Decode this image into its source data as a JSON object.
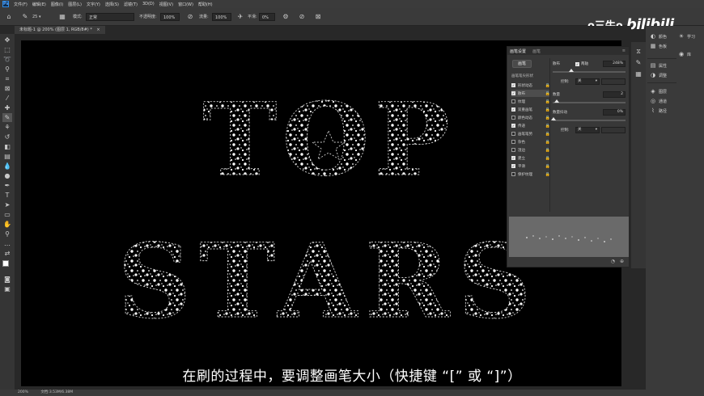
{
  "menu": {
    "logo": "Ps",
    "items": [
      "文件(F)",
      "编辑(E)",
      "图像(I)",
      "图层(L)",
      "文字(Y)",
      "选择(S)",
      "滤镜(T)",
      "3D(D)",
      "视图(V)",
      "窗口(W)",
      "帮助(H)"
    ]
  },
  "options": {
    "brush_size": "25",
    "mode_label": "模式:",
    "mode_value": "正常",
    "opacity_label": "不透明度:",
    "opacity_value": "100%",
    "flow_label": "流量:",
    "flow_value": "100%",
    "smooth_label": "平滑:",
    "smooth_value": "0%"
  },
  "document": {
    "tab_label": "未标题-1 @ 200% (图层 1, RGB/8#) *",
    "close": "×"
  },
  "canvas": {
    "line1": "TOP",
    "line2": "STARS"
  },
  "status": {
    "zoom": "200%",
    "doc": "文档:3.53M/6.38M"
  },
  "right_dock": {
    "items": [
      {
        "icon": "palette-icon",
        "label": "颜色"
      },
      {
        "icon": "swatches-icon",
        "label": "色板"
      },
      {
        "icon": "learn-icon",
        "label": "学习"
      },
      {
        "icon": "library-icon",
        "label": "库"
      },
      {
        "icon": "properties-icon",
        "label": "属性"
      },
      {
        "icon": "adjustments-icon",
        "label": "调整"
      },
      {
        "icon": "layers-icon",
        "label": "图层"
      },
      {
        "icon": "channels-icon",
        "label": "通道"
      },
      {
        "icon": "paths-icon",
        "label": "路径"
      }
    ]
  },
  "brush_panel": {
    "tabs": [
      "画笔设置",
      "画笔"
    ],
    "brushes_button": "画笔",
    "tip_shape_label": "画笔笔尖形状",
    "rows": [
      {
        "label": "形状动态",
        "checked": true,
        "active": false
      },
      {
        "label": "散布",
        "checked": true,
        "active": true
      },
      {
        "label": "纹理",
        "checked": false,
        "active": false
      },
      {
        "label": "双重画笔",
        "checked": true,
        "active": false
      },
      {
        "label": "颜色动态",
        "checked": false,
        "active": false
      },
      {
        "label": "传递",
        "checked": true,
        "active": false
      },
      {
        "label": "画笔笔势",
        "checked": false,
        "active": false
      },
      {
        "label": "杂色",
        "checked": false,
        "active": false
      },
      {
        "label": "湿边",
        "checked": false,
        "active": false
      },
      {
        "label": "建立",
        "checked": true,
        "active": false
      },
      {
        "label": "平滑",
        "checked": true,
        "active": false
      },
      {
        "label": "保护纹理",
        "checked": false,
        "active": false
      }
    ],
    "scatter_label": "散布",
    "both_axes_label": "两轴",
    "scatter_value": "248%",
    "control_label": "控制:",
    "control_value": "关",
    "count_label": "数量",
    "count_value": "2",
    "count_jitter_label": "数量抖动",
    "count_jitter_value": "0%",
    "control2_value": "关"
  },
  "subtitle": "在刷的过程中，要调整画笔大小（快捷键 “[” 或 “]”）",
  "watermark": {
    "left": "o三牛o",
    "right": "bilibili"
  }
}
